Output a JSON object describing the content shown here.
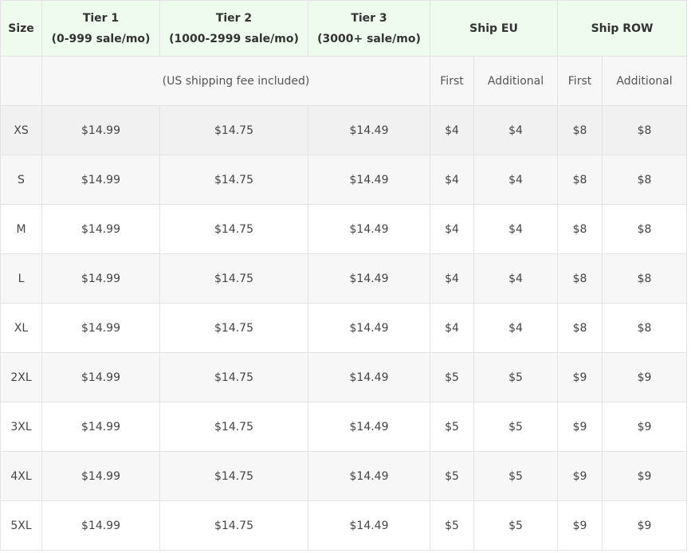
{
  "header": {
    "size": "Size",
    "tier1_title": "Tier 1",
    "tier1_sub": "(0-999 sale/mo)",
    "tier2_title": "Tier 2",
    "tier2_sub": "(1000-2999 sale/mo)",
    "tier3_title": "Tier 3",
    "tier3_sub": "(3000+ sale/mo)",
    "ship_eu": "Ship EU",
    "ship_row": "Ship ROW"
  },
  "subheader": {
    "note": "(US shipping fee included)",
    "eu_first": "First",
    "eu_additional": "Additional",
    "row_first": "First",
    "row_additional": "Additional"
  },
  "rows": [
    {
      "size": "XS",
      "tier1": "$14.99",
      "tier2": "$14.75",
      "tier3": "$14.49",
      "eu_first": "$4",
      "eu_add": "$4",
      "row_first": "$8",
      "row_add": "$8"
    },
    {
      "size": "S",
      "tier1": "$14.99",
      "tier2": "$14.75",
      "tier3": "$14.49",
      "eu_first": "$4",
      "eu_add": "$4",
      "row_first": "$8",
      "row_add": "$8"
    },
    {
      "size": "M",
      "tier1": "$14.99",
      "tier2": "$14.75",
      "tier3": "$14.49",
      "eu_first": "$4",
      "eu_add": "$4",
      "row_first": "$8",
      "row_add": "$8"
    },
    {
      "size": "L",
      "tier1": "$14.99",
      "tier2": "$14.75",
      "tier3": "$14.49",
      "eu_first": "$4",
      "eu_add": "$4",
      "row_first": "$8",
      "row_add": "$8"
    },
    {
      "size": "XL",
      "tier1": "$14.99",
      "tier2": "$14.75",
      "tier3": "$14.49",
      "eu_first": "$4",
      "eu_add": "$4",
      "row_first": "$8",
      "row_add": "$8"
    },
    {
      "size": "2XL",
      "tier1": "$14.99",
      "tier2": "$14.75",
      "tier3": "$14.49",
      "eu_first": "$5",
      "eu_add": "$5",
      "row_first": "$9",
      "row_add": "$9"
    },
    {
      "size": "3XL",
      "tier1": "$14.99",
      "tier2": "$14.75",
      "tier3": "$14.49",
      "eu_first": "$5",
      "eu_add": "$5",
      "row_first": "$9",
      "row_add": "$9"
    },
    {
      "size": "4XL",
      "tier1": "$14.99",
      "tier2": "$14.75",
      "tier3": "$14.49",
      "eu_first": "$5",
      "eu_add": "$5",
      "row_first": "$9",
      "row_add": "$9"
    },
    {
      "size": "5XL",
      "tier1": "$14.99",
      "tier2": "$14.75",
      "tier3": "$14.49",
      "eu_first": "$5",
      "eu_add": "$5",
      "row_first": "$9",
      "row_add": "$9"
    }
  ],
  "colors": {
    "header_bg": "#effbef",
    "border": "#e3e3e3",
    "stripe": "#f7f7f7"
  }
}
